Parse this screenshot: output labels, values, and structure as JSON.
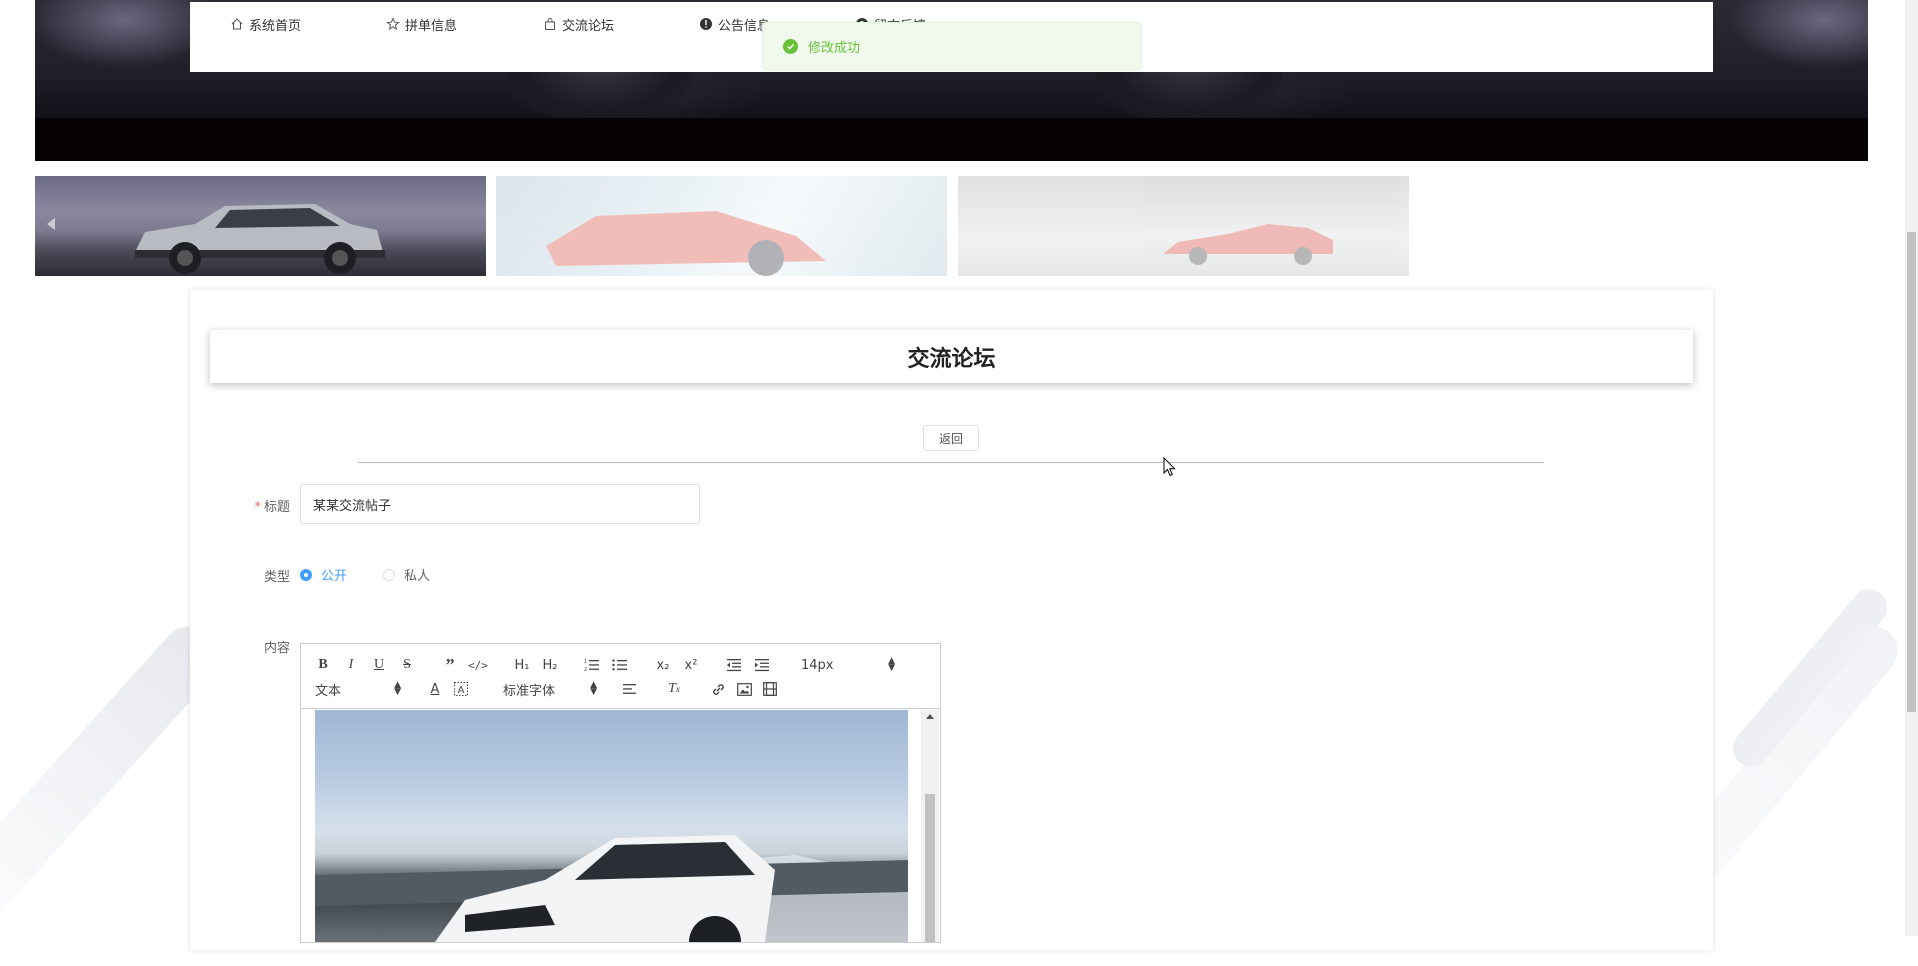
{
  "nav": {
    "items": [
      {
        "label": "系统首页",
        "icon": "home-icon"
      },
      {
        "label": "拼单信息",
        "icon": "star-icon"
      },
      {
        "label": "交流论坛",
        "icon": "bag-icon"
      },
      {
        "label": "公告信息",
        "icon": "info-icon"
      },
      {
        "label": "留言反馈",
        "icon": "help-icon"
      }
    ]
  },
  "toast": {
    "message": "修改成功",
    "color": "#67c23a"
  },
  "page": {
    "title": "交流论坛",
    "back_label": "返回"
  },
  "form": {
    "title_label": "标题",
    "title_value": "某某交流帖子",
    "type_label": "类型",
    "type_options": [
      "公开",
      "私人"
    ],
    "type_selected": "公开",
    "content_label": "内容"
  },
  "editor": {
    "size_select": "14px",
    "header_select": "文本",
    "font_select": "标准字体",
    "buttons": [
      "bold-icon",
      "italic-icon",
      "underline-icon",
      "strike-icon",
      "blockquote-icon",
      "code-icon",
      "h1-icon",
      "h2-icon",
      "ordered-list-icon",
      "bullet-list-icon",
      "subscript-icon",
      "superscript-icon",
      "outdent-icon",
      "indent-icon",
      "font-color-icon",
      "background-color-icon",
      "align-icon",
      "clear-format-icon",
      "link-icon",
      "image-icon",
      "video-icon"
    ]
  },
  "colors": {
    "accent": "#409eff",
    "required": "#f56c6c",
    "success": "#67c23a"
  }
}
